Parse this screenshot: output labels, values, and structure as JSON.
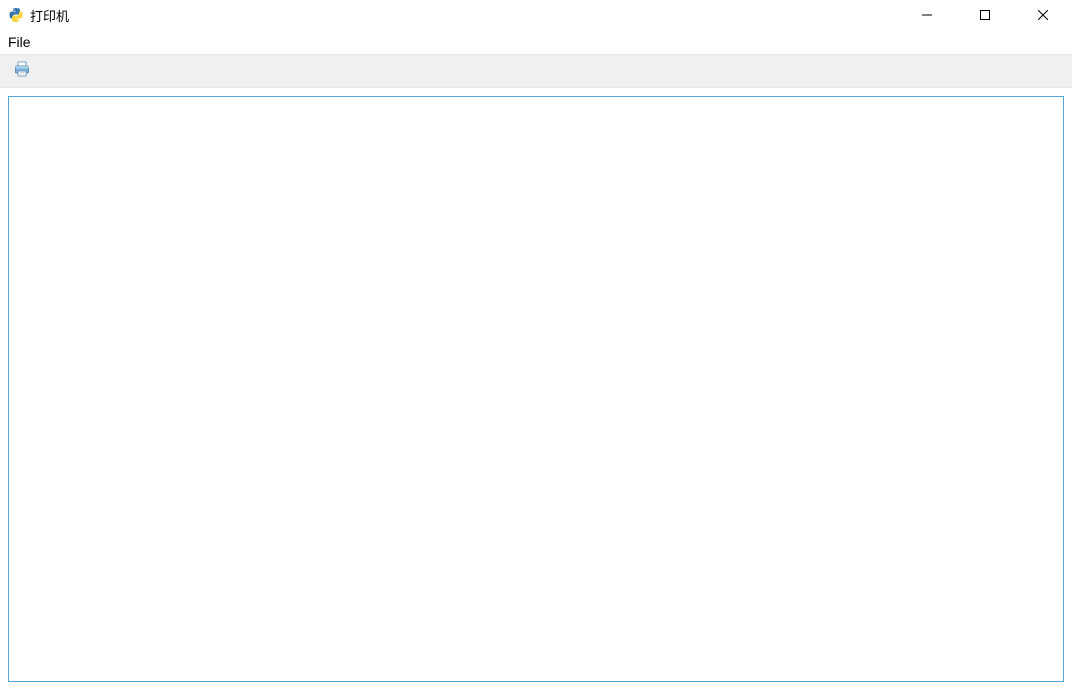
{
  "window": {
    "title": "打印机"
  },
  "menubar": {
    "file_label": "File"
  },
  "toolbar": {
    "print_icon_name": "printer-icon"
  },
  "editor": {
    "content": ""
  }
}
